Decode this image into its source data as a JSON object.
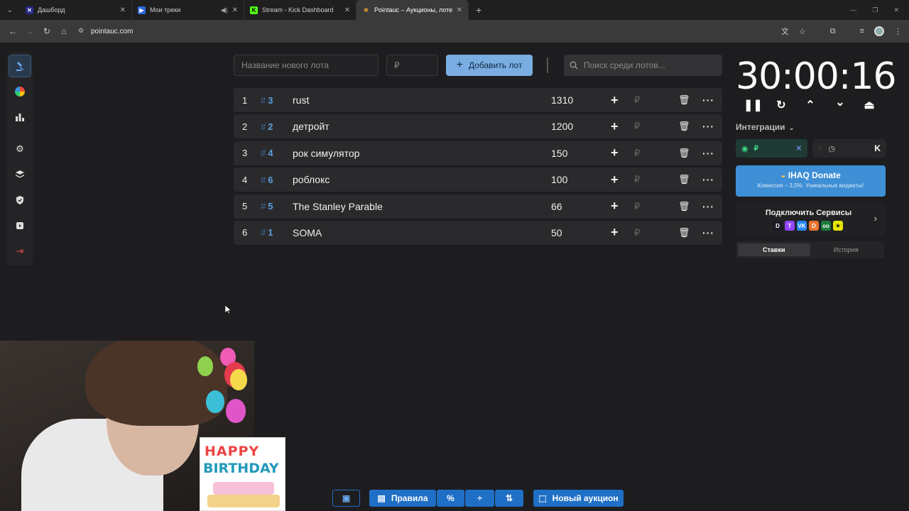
{
  "browser": {
    "tabs": [
      {
        "title": "Дашборд",
        "fav_color": "#2a2a8a",
        "fav_glyph": "✕",
        "active": false
      },
      {
        "title": "Мои треки",
        "fav_color": "#2d6ae0",
        "fav_glyph": "▶",
        "active": false,
        "audio": true
      },
      {
        "title": "Stream - Kick Dashboard",
        "fav_color": "#53fc18",
        "fav_glyph": "K",
        "active": false
      },
      {
        "title": "Pointauc – Аукционы, лотере",
        "fav_color": "#e0a030",
        "fav_glyph": "✻",
        "active": true
      }
    ],
    "url": "pointauc.com"
  },
  "form": {
    "lot_name_placeholder": "Название нового лота",
    "amount_placeholder": "₽",
    "add_button": "Добавить лот",
    "search_placeholder": "Поиск среди лотов..."
  },
  "lots": [
    {
      "index": "1",
      "id": "3",
      "name": "rust",
      "amount": "1310"
    },
    {
      "index": "2",
      "id": "2",
      "name": "детройт",
      "amount": "1200"
    },
    {
      "index": "3",
      "id": "4",
      "name": "рок симулятор",
      "amount": "150"
    },
    {
      "index": "4",
      "id": "6",
      "name": "роблокс",
      "amount": "100"
    },
    {
      "index": "5",
      "id": "5",
      "name": "The Stanley Parable",
      "amount": "66"
    },
    {
      "index": "6",
      "id": "1",
      "name": "SOMA",
      "amount": "50"
    }
  ],
  "lot_row": {
    "hash": "#",
    "plus": "+",
    "currency": "₽",
    "more": "···"
  },
  "timer": {
    "value": "30:00:16"
  },
  "integrations": {
    "label": "Интеграции",
    "donate_title": "IHAQ Donate",
    "donate_subtitle": "Комиссия – 3,5%. Уникальные виджеты!",
    "services_title": "Подключить Сервисы",
    "tabs": [
      "Ставки",
      "История"
    ]
  },
  "bottom": {
    "rules": "Правила",
    "percent": "%",
    "new_auction": "Новый аукцион"
  },
  "overlay": {
    "happy": "HAPPY",
    "birthday": "BIRTHDAY"
  },
  "colors": {
    "accent": "#7aaee3",
    "hash_blue": "#5d9ee0",
    "donate_blue": "#3e8fd6",
    "toolbar_blue": "#1e6fc5"
  }
}
